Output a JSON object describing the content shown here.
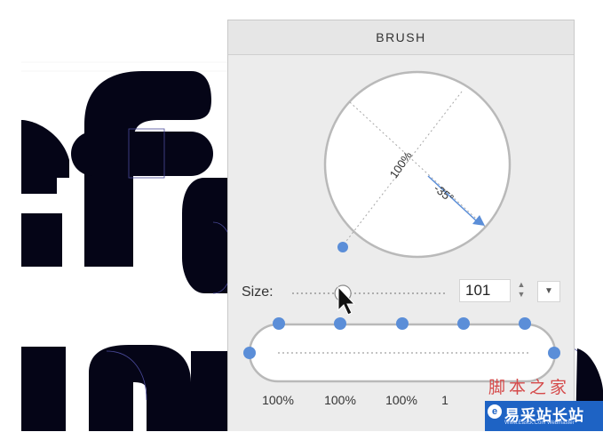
{
  "panel": {
    "title": "BRUSH",
    "roundness_label": "100%",
    "angle_label": "-35°",
    "size_label": "Size:",
    "size_value": "101",
    "size_slider_value": 0.33,
    "stepper_up": "▲",
    "stepper_down": "▼",
    "dropdown_glyph": "▼",
    "pressure_percentages": [
      "100%",
      "100%",
      "100%",
      "1"
    ]
  },
  "watermark": {
    "top_text": "脚本之家",
    "brand_text": "易采站长站",
    "sub_text": "Www.Easck.Com Webmaster",
    "logo_glyph": "e"
  },
  "colors": {
    "accent": "#5b8ed8",
    "glyph": "#050517",
    "panel_bg": "#ececec"
  },
  "icons": [
    "arrow-cursor-icon",
    "dropdown-arrow-icon",
    "stepper-icon"
  ]
}
